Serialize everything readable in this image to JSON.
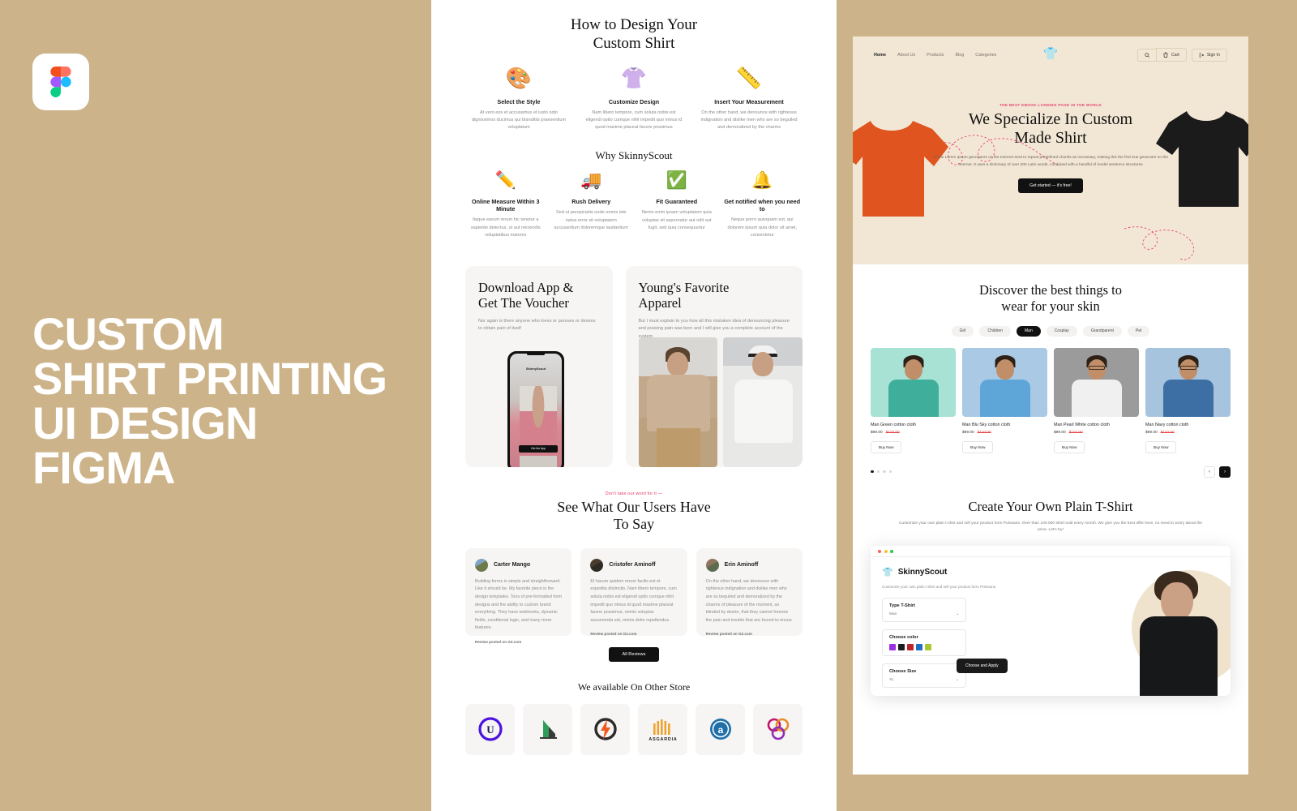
{
  "left": {
    "logo_icon": "figma-logo-icon",
    "title_lines": [
      "CUSTOM",
      "SHIRT PRINTING",
      "UI DESIGN",
      "FIGMA"
    ],
    "bg_color": "#cdb389"
  },
  "middle": {
    "howto": {
      "title": "How to Design Your\nCustom Shirt",
      "steps": [
        {
          "icon": "color-palette-icon",
          "glyph": "🎨",
          "title": "Select the Style",
          "text": "At vero eos et accusamus et iusto odio dignissimos ducimus qui blanditiis praesentium voluptatum"
        },
        {
          "icon": "tshirt-icon",
          "glyph": "👚",
          "title": "Customize Design",
          "text": "Nam libero tempore, cum soluta nobis est eligendi optio cumque nihil impedit quo minus id quod maxime placeat facere possimus"
        },
        {
          "icon": "tape-measure-icon",
          "glyph": "📏",
          "title": "Insert Your Measurement",
          "text": "On the other hand, we denounce with righteous indignation and dislike men who are so beguiled and demoralized by the charms"
        }
      ]
    },
    "why": {
      "title": "Why SkinnyScout",
      "items": [
        {
          "icon": "pencils-icon",
          "glyph": "✏️",
          "title": "Online Measure Within 3 Minute",
          "text": "Itaque earum rerum hic tenetur a sapiente delectus, ut aut reiciendis voluptatibus maiores"
        },
        {
          "icon": "delivery-truck-icon",
          "glyph": "🚚",
          "title": "Rush Delivery",
          "text": "Sed ut perspiciatis unde omnis iste natus error sit voluptatem accusantium doloremque laudantium"
        },
        {
          "icon": "shield-check-icon",
          "glyph": "✅",
          "title": "Fit Guaranteed",
          "text": "Nemo enim ipsam voluptatem quia voluptas sit aspernatur aut odit aut fugit, sed quia consequuntur"
        },
        {
          "icon": "bell-icon",
          "glyph": "🔔",
          "title": "Get notified when you need to",
          "text": "Neque porro quisquam est, qui dolorem ipsum quia dolor sit amet, consectetur"
        }
      ]
    },
    "download_card": {
      "title": "Download App &\nGet The Voucher",
      "text": "Nor again is there anyone who loves or pursues or desires to obtain pain of itself",
      "phone_brand": "SkinnyScout",
      "phone_cta": "Get the App"
    },
    "apparel_card": {
      "title": "Young's Favorite\nApparel",
      "text": "But I must explain to you how all this mistaken idea of denouncing pleasure and praising pain was born and I will give you a complete account of the system"
    },
    "testimonials": {
      "eyebrow": "Don't take our word for it —",
      "title": "See What Our Users Have\nTo Say",
      "cards": [
        {
          "name": "Carter Mango",
          "body": "Building forms is simple and straightforward. Like it should be. My favorite piece is the design templates. Tons of pre-formatted form designs and the ability to custom brand everything. They have webhooks, dynamic fields, conditional logic, and many more features.",
          "source": "Review posted on G2.com"
        },
        {
          "name": "Cristofer Aminoff",
          "body": "Et harum quidem rerum facilis est et expedita distinctio. Nam libero tempore, cum soluta nobis est eligendi optio cumque nihil impedit quo minus id quod maxime placeat facere possimus, omnis voluptas assumenda est, omnis dolor repellendus.",
          "source": "Review posted on G2.com"
        },
        {
          "name": "Erin Aminoff",
          "body": "On the other hand, we denounce with righteous indignation and dislike men who are so beguiled and demoralized by the charms of pleasure of the moment, so blinded by desire, that they cannot foresee the pain and trouble that are bound to ensue",
          "source": "Review posted on G2.com"
        }
      ],
      "button": "All Reviews"
    },
    "stores": {
      "title": "We available On Other Store",
      "logos": [
        {
          "name": "unity-logo-icon",
          "label": "U"
        },
        {
          "name": "building-logo-icon",
          "label": ""
        },
        {
          "name": "lightning-bolt-logo-icon",
          "label": ""
        },
        {
          "name": "asgardia-logo-icon",
          "label": "ASGARDIA"
        },
        {
          "name": "a-badge-logo-icon",
          "label": "a"
        },
        {
          "name": "trefoil-logo-icon",
          "label": ""
        }
      ]
    }
  },
  "right": {
    "nav": {
      "links": [
        "Home",
        "About Us",
        "Products",
        "Blog",
        "Categories"
      ],
      "active": "Home",
      "logo_icon": "tshirt-logo-icon",
      "search_icon": "search-icon",
      "cart_icon": "cart-icon",
      "cart_label": "Cart",
      "signin_icon": "sign-in-icon",
      "signin_label": "Sign In"
    },
    "hero": {
      "eyebrow": "THE BEST EBOOK LANDING PAGE IN THE WORLD",
      "title": "We Specialize In Custom\nMade Shirt",
      "desc": "All the Lorem Ipsum generators on the Internet tend to repeat predefined chunks as necessary, making this the first true generator on the Internet. It uses a dictionary of over 200 Latin words, combined with a handful of model sentence structures",
      "cta": "Get started — it's free!",
      "bg_color": "#f2e7d5",
      "left_shirt_color": "#e0541f",
      "right_shirt_color": "#1b1b1b"
    },
    "discover": {
      "title": "Discover the best things to\nwear for your skin",
      "chips": [
        "Girl",
        "Children",
        "Man",
        "Cosplay",
        "Grandparent",
        "Pet"
      ],
      "active_chip": "Man",
      "products": [
        {
          "name": "Man Green cotton cloth",
          "price": "$99.00",
          "old_price": "$110.00",
          "buy": "Buy Now",
          "swatch": "#a8e2d5"
        },
        {
          "name": "Man Blu Sky cotton cloth",
          "price": "$99.00",
          "old_price": "$110.00",
          "buy": "Buy Now",
          "swatch": "#a9c9e4"
        },
        {
          "name": "Man Pearl White cotton cloth",
          "price": "$99.00",
          "old_price": "$110.00",
          "buy": "Buy Now",
          "swatch": "#9b9b9b"
        },
        {
          "name": "Man Navy cotton cloth",
          "price": "$99.00",
          "old_price": "$110.00",
          "buy": "Buy Now",
          "swatch": "#a7c4de"
        }
      ],
      "dots": 4,
      "active_dot": 1,
      "prev_icon": "chevron-left-icon",
      "next_icon": "chevron-right-icon"
    },
    "create": {
      "title": "Create Your Own Plain T-Shirt",
      "desc": "Customize your own plain t-shirt and sell your product form Polosans. Over than 100.000 tshirt sold every month. We give you the best offer here, no need to worry about the price. Let's try!",
      "browser": {
        "brand": "SkinnyScout",
        "brand_icon": "tshirt-logo-icon",
        "desc": "Customize your own plain t-shirt and sell your product form Polosans.",
        "fields": [
          {
            "label": "Type T-Shirt",
            "value": "Man",
            "caret": "chevron-down-icon"
          },
          {
            "label": "Choose color",
            "value": "",
            "swatches": [
              "#9b30e0",
              "#1c1c1c",
              "#c0242b",
              "#1f6fc4",
              "#a8c832"
            ]
          },
          {
            "label": "Choose Size",
            "value": "XL",
            "caret": "chevron-down-icon"
          }
        ],
        "apply_button": "Choose and Apply"
      }
    }
  }
}
